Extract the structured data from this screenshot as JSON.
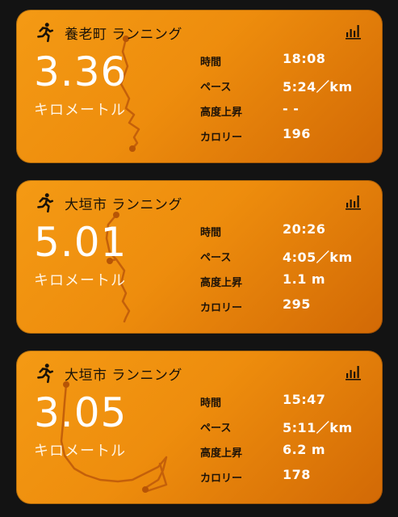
{
  "cards": [
    {
      "title": "養老町 ランニング",
      "distance": "3.36",
      "unit": "キロメートル",
      "stats": [
        {
          "label": "時間",
          "value": "18:08"
        },
        {
          "label": "ペース",
          "value": "5:24／km"
        },
        {
          "label": "高度上昇",
          "value": "- -"
        },
        {
          "label": "カロリー",
          "value": "196"
        }
      ]
    },
    {
      "title": "大垣市 ランニング",
      "distance": "5.01",
      "unit": "キロメートル",
      "stats": [
        {
          "label": "時間",
          "value": "20:26"
        },
        {
          "label": "ペース",
          "value": "4:05／km"
        },
        {
          "label": "高度上昇",
          "value": "1.1 m"
        },
        {
          "label": "カロリー",
          "value": "295"
        }
      ]
    },
    {
      "title": "大垣市 ランニング",
      "distance": "3.05",
      "unit": "キロメートル",
      "stats": [
        {
          "label": "時間",
          "value": "15:47"
        },
        {
          "label": "ペース",
          "value": "5:11／km"
        },
        {
          "label": "高度上昇",
          "value": "6.2 m"
        },
        {
          "label": "カロリー",
          "value": "178"
        }
      ]
    }
  ],
  "icons": {
    "activity": "runner-icon",
    "stats": "bar-chart-icon"
  },
  "colors": {
    "card_gradient_start": "#f49a14",
    "card_gradient_end": "#d26905",
    "route_line": "#c4600a",
    "background": "#131313"
  }
}
